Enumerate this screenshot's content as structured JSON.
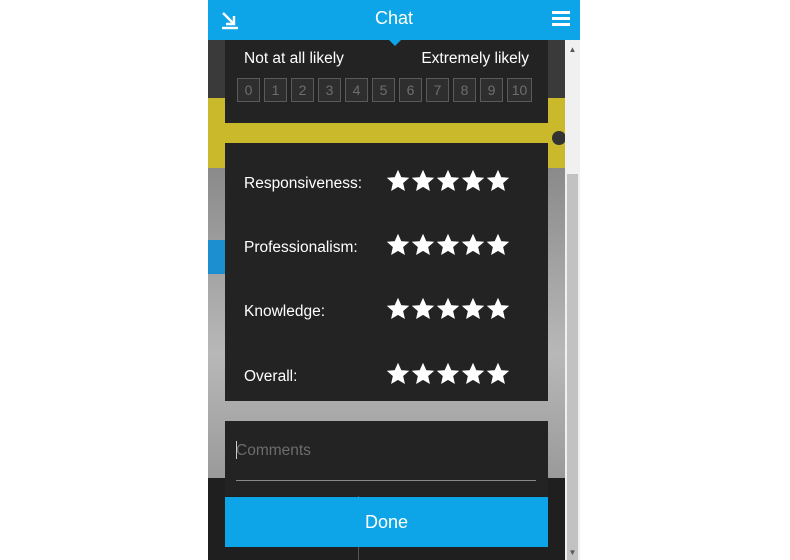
{
  "header": {
    "title": "Chat",
    "minimize_icon": "minimize-arrow-icon",
    "menu_icon": "hamburger-menu-icon"
  },
  "nps": {
    "low_label": "Not at all likely",
    "high_label": "Extremely likely",
    "options": [
      "0",
      "1",
      "2",
      "3",
      "4",
      "5",
      "6",
      "7",
      "8",
      "9",
      "10"
    ]
  },
  "ratings": {
    "rows": [
      {
        "label": "Responsiveness:",
        "stars": 5
      },
      {
        "label": "Professionalism:",
        "stars": 5
      },
      {
        "label": "Knowledge:",
        "stars": 5
      },
      {
        "label": "Overall:",
        "stars": 5
      }
    ]
  },
  "comments": {
    "placeholder": "Comments",
    "value": ""
  },
  "done_label": "Done",
  "colors": {
    "accent": "#0da5e8",
    "panel": "#232323",
    "star": "#ffffff"
  }
}
